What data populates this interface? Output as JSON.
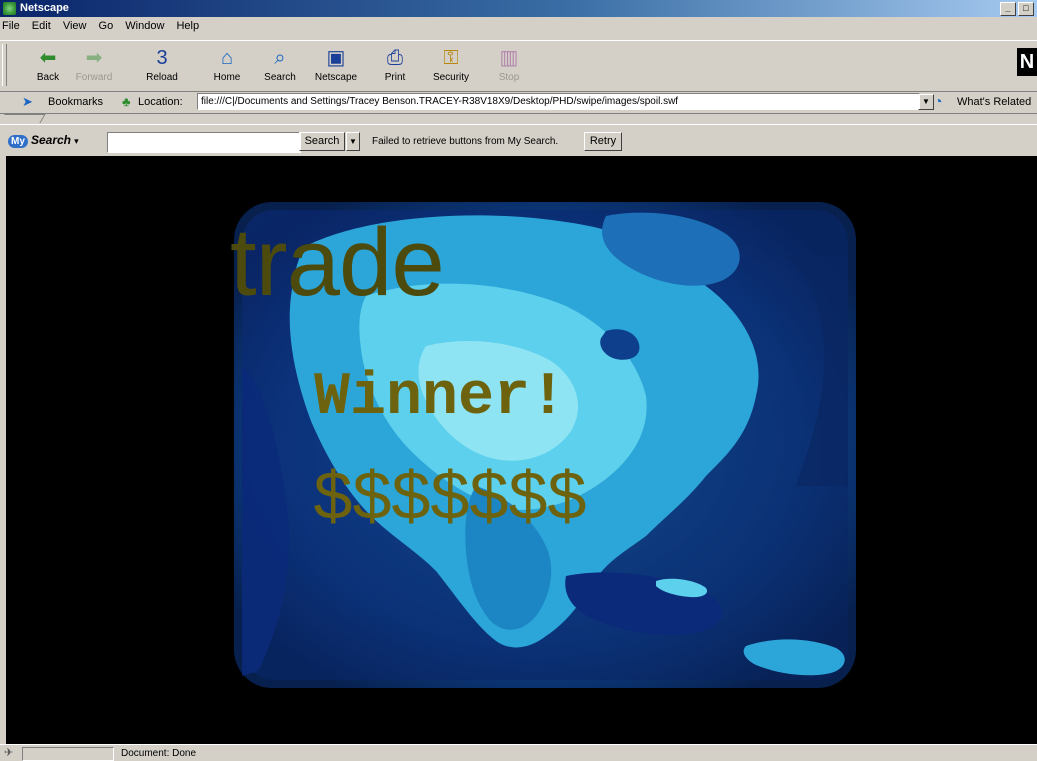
{
  "window": {
    "title": "Netscape",
    "controls": [
      "_",
      "□"
    ]
  },
  "menu": [
    "File",
    "Edit",
    "View",
    "Go",
    "Window",
    "Help"
  ],
  "toolbar": [
    {
      "label": "Back",
      "icon": "back-arrow-icon",
      "glyph": "⬅",
      "color": "#2e8b2e",
      "enabled": true
    },
    {
      "label": "Forward",
      "icon": "forward-arrow-icon",
      "glyph": "➡",
      "color": "#2e8b2e",
      "enabled": false
    },
    {
      "label": "Reload",
      "icon": "reload-icon",
      "glyph": "3",
      "color": "#1a3f99",
      "enabled": true
    },
    {
      "label": "Home",
      "icon": "home-icon",
      "glyph": "⌂",
      "color": "#1a66c2",
      "enabled": true
    },
    {
      "label": "Search",
      "icon": "search-icon",
      "glyph": "⌕",
      "color": "#1a66c2",
      "enabled": true
    },
    {
      "label": "Netscape",
      "icon": "netscape-icon",
      "glyph": "▣",
      "color": "#1a3f99",
      "enabled": true
    },
    {
      "label": "Print",
      "icon": "printer-icon",
      "glyph": "⎙",
      "color": "#1a3f99",
      "enabled": true
    },
    {
      "label": "Security",
      "icon": "padlock-icon",
      "glyph": "⚿",
      "color": "#b8860b",
      "enabled": true
    },
    {
      "label": "Stop",
      "icon": "stop-icon",
      "glyph": "▥",
      "color": "#8a2a8a",
      "enabled": false
    }
  ],
  "location": {
    "bookmarks_label": "Bookmarks",
    "location_label": "Location:",
    "url": "file:///C|/Documents and Settings/Tracey Benson.TRACEY-R38V18X9/Desktop/PHD/swipe/images/spoil.swf",
    "related_label": "What's Related"
  },
  "search": {
    "logo_badge": "My",
    "logo_text": "Search",
    "input_value": "",
    "button_label": "Search",
    "message": "Failed to retrieve buttons from My Search.",
    "retry_label": "Retry"
  },
  "content": {
    "word1": "trade",
    "word2": "Winner!",
    "word3": "$$$$$$$"
  },
  "status": {
    "text": "Document: Done"
  }
}
